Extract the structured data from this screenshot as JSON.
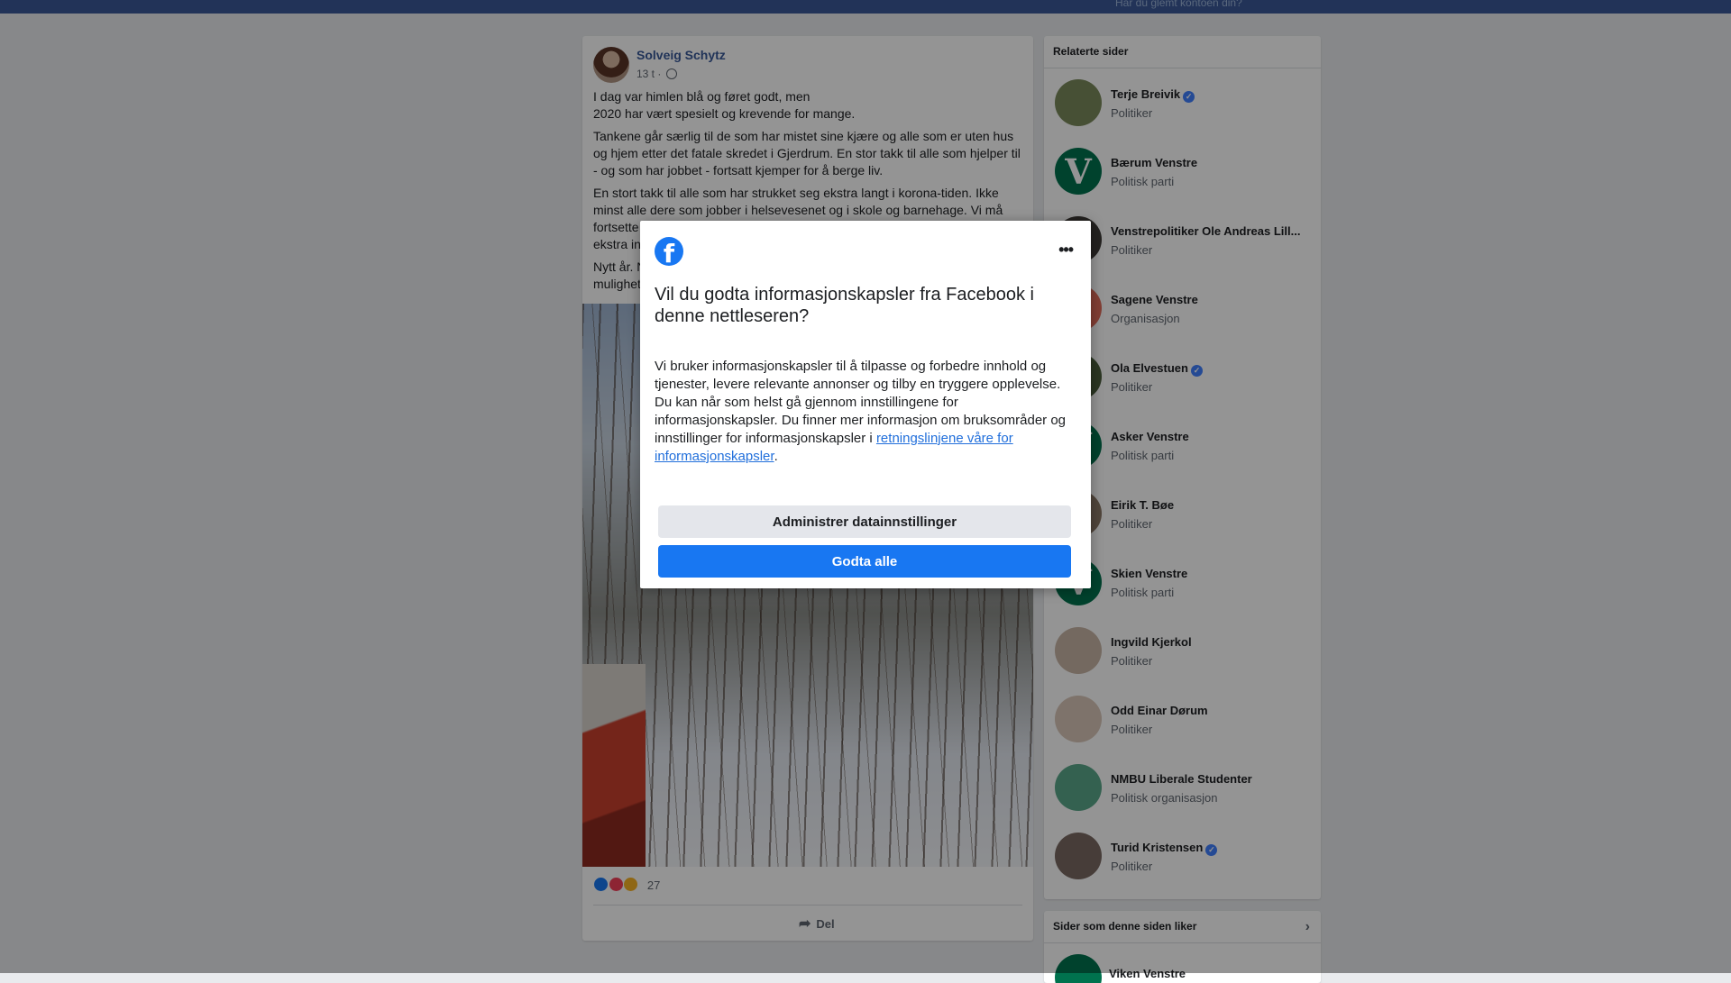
{
  "topbar": {
    "forgot_text": "Har du glemt kontoen din?"
  },
  "post": {
    "author": "Solveig Schytz",
    "time": "13 t ·",
    "paragraphs": [
      "I dag var himlen blå og føret godt, men\n2020 har vært spesielt og krevende for mange.",
      "Tankene går særlig til de som har mistet sine kjære og alle som er uten hus og hjem etter det fatale skredet i Gjerdrum. En stor takk til alle som hjelper til - og som har jobbet - fortsatt kjemper for å berge liv.",
      "En stort takk til alle som har strukket seg ekstra langt i korona-tiden. Ikke minst alle dere som jobber i helsevesenet og i skole og barnehage. Vi må fortsette",
      "Nytt år. N"
    ],
    "para3_cont": "ekstra in",
    "para4_cont": "mulighet",
    "reaction_count": "27",
    "share_label": "Del"
  },
  "sidebar": {
    "heading": "Relaterte sider",
    "pages": [
      {
        "name": "Terje Breivik",
        "category": "Politiker",
        "verified": true
      },
      {
        "name": "Bærum Venstre",
        "category": "Politisk parti",
        "verified": false
      },
      {
        "name": "Venstrepolitiker Ole Andreas Lill...",
        "category": "Politiker",
        "verified": false
      },
      {
        "name": "Sagene Venstre",
        "category": "Organisasjon",
        "verified": false
      },
      {
        "name": "Ola Elvestuen",
        "category": "Politiker",
        "verified": true
      },
      {
        "name": "Asker Venstre",
        "category": "Politisk parti",
        "verified": false
      },
      {
        "name": "Eirik T. Bøe",
        "category": "Politiker",
        "verified": false
      },
      {
        "name": "Skien Venstre",
        "category": "Politisk parti",
        "verified": false
      },
      {
        "name": "Ingvild Kjerkol",
        "category": "Politiker",
        "verified": false
      },
      {
        "name": "Odd Einar Dørum",
        "category": "Politiker",
        "verified": false
      },
      {
        "name": "NMBU Liberale Studenter",
        "category": "Politisk organisasjon",
        "verified": false
      },
      {
        "name": "Turid Kristensen",
        "category": "Politiker",
        "verified": true
      }
    ]
  },
  "sidebar2": {
    "heading": "Sider som denne siden liker",
    "next_name": "Viken Venstre"
  },
  "modal": {
    "title": "Vil du godta informasjonskapsler fra Facebook i denne nettleseren?",
    "body": "Vi bruker informasjonskapsler til å tilpasse og forbedre innhold og tjenester, levere relevante annonser og tilby en tryggere opplevelse. Du kan når som helst gå gjennom innstillingene for informasjonskapsler. Du finner mer informasjon om bruksområder og innstillinger for informasjonskapsler i ",
    "link_text": "retningslinjene våre for informasjonskapsler",
    "body_end": ".",
    "manage_button": "Administrer datainnstillinger",
    "accept_button": "Godta alle"
  },
  "colors": {
    "facebook_blue": "#1877f2",
    "overlay": "rgba(0,0,0,0.42)",
    "topbar": "#3b5998"
  }
}
